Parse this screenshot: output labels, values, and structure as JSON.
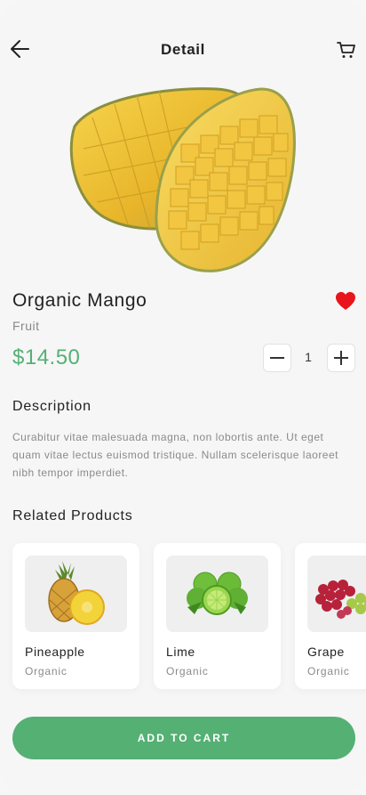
{
  "header": {
    "title": "Detail",
    "back_icon": "arrow-left-icon",
    "cart_icon": "cart-icon"
  },
  "product": {
    "name": "Organic Mango",
    "category": "Fruit",
    "price": "$14.50",
    "favorite": true,
    "quantity": "1"
  },
  "description": {
    "title": "Description",
    "text": "Curabitur vitae malesuada magna, non lobortis ante. Ut eget quam vitae lectus euismod tristique. Nullam scelerisque laoreet nibh tempor imperdiet."
  },
  "related": {
    "title": "Related Products",
    "items": [
      {
        "name": "Pineapple",
        "sub": "Organic",
        "icon": "pineapple-image"
      },
      {
        "name": "Lime",
        "sub": "Organic",
        "icon": "lime-image"
      },
      {
        "name": "Grape",
        "sub": "Organic",
        "icon": "grape-image"
      }
    ]
  },
  "cta": {
    "label": "ADD TO CART"
  },
  "colors": {
    "accent": "#55b074",
    "heart": "#e8161c",
    "background": "#f6f6f6"
  }
}
